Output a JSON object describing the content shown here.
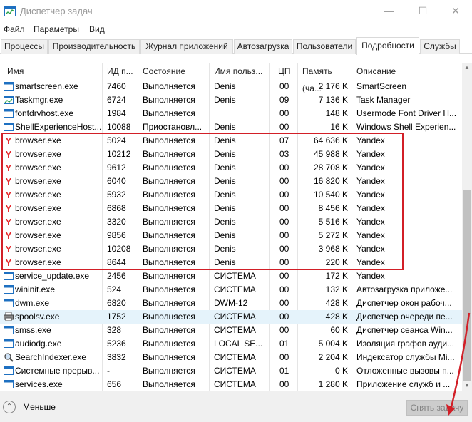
{
  "window": {
    "title": "Диспетчер задач",
    "minimize": "—",
    "maximize": "☐",
    "close": "✕"
  },
  "menu": [
    "Файл",
    "Параметры",
    "Вид"
  ],
  "tabs": [
    {
      "label": "Процессы"
    },
    {
      "label": "Производительность"
    },
    {
      "label": "Журнал приложений"
    },
    {
      "label": "Автозагрузка"
    },
    {
      "label": "Пользователи"
    },
    {
      "label": "Подробности",
      "active": true
    },
    {
      "label": "Службы"
    }
  ],
  "columns": [
    "Имя",
    "ИД п...",
    "Состояние",
    "Имя польз...",
    "ЦП",
    "Память (ча...",
    "Описание"
  ],
  "sort_indicator": "^",
  "processes": [
    {
      "name": "smartscreen.exe",
      "pid": "7460",
      "status": "Выполняется",
      "user": "Denis",
      "cpu": "00",
      "mem": "2 176 K",
      "desc": "SmartScreen",
      "icon": "app-window-icon"
    },
    {
      "name": "Taskmgr.exe",
      "pid": "6724",
      "status": "Выполняется",
      "user": "Denis",
      "cpu": "09",
      "mem": "7 136 K",
      "desc": "Task Manager",
      "icon": "task-manager-icon"
    },
    {
      "name": "fontdrvhost.exe",
      "pid": "1984",
      "status": "Выполняется",
      "user": "",
      "cpu": "00",
      "mem": "148 K",
      "desc": "Usermode Font Driver H...",
      "icon": "app-window-icon"
    },
    {
      "name": "ShellExperienceHost....",
      "pid": "10088",
      "status": "Приостановл...",
      "user": "Denis",
      "cpu": "00",
      "mem": "16 K",
      "desc": "Windows Shell Experien...",
      "icon": "app-window-icon"
    },
    {
      "name": "browser.exe",
      "pid": "5024",
      "status": "Выполняется",
      "user": "Denis",
      "cpu": "07",
      "mem": "64 636 K",
      "desc": "Yandex",
      "icon": "yandex-icon"
    },
    {
      "name": "browser.exe",
      "pid": "10212",
      "status": "Выполняется",
      "user": "Denis",
      "cpu": "03",
      "mem": "45 988 K",
      "desc": "Yandex",
      "icon": "yandex-icon"
    },
    {
      "name": "browser.exe",
      "pid": "9612",
      "status": "Выполняется",
      "user": "Denis",
      "cpu": "00",
      "mem": "28 708 K",
      "desc": "Yandex",
      "icon": "yandex-icon"
    },
    {
      "name": "browser.exe",
      "pid": "6040",
      "status": "Выполняется",
      "user": "Denis",
      "cpu": "00",
      "mem": "16 820 K",
      "desc": "Yandex",
      "icon": "yandex-icon"
    },
    {
      "name": "browser.exe",
      "pid": "5932",
      "status": "Выполняется",
      "user": "Denis",
      "cpu": "00",
      "mem": "10 540 K",
      "desc": "Yandex",
      "icon": "yandex-icon"
    },
    {
      "name": "browser.exe",
      "pid": "6868",
      "status": "Выполняется",
      "user": "Denis",
      "cpu": "00",
      "mem": "8 456 K",
      "desc": "Yandex",
      "icon": "yandex-icon"
    },
    {
      "name": "browser.exe",
      "pid": "3320",
      "status": "Выполняется",
      "user": "Denis",
      "cpu": "00",
      "mem": "5 516 K",
      "desc": "Yandex",
      "icon": "yandex-icon"
    },
    {
      "name": "browser.exe",
      "pid": "9856",
      "status": "Выполняется",
      "user": "Denis",
      "cpu": "00",
      "mem": "5 272 K",
      "desc": "Yandex",
      "icon": "yandex-icon"
    },
    {
      "name": "browser.exe",
      "pid": "10208",
      "status": "Выполняется",
      "user": "Denis",
      "cpu": "00",
      "mem": "3 968 K",
      "desc": "Yandex",
      "icon": "yandex-icon"
    },
    {
      "name": "browser.exe",
      "pid": "8644",
      "status": "Выполняется",
      "user": "Denis",
      "cpu": "00",
      "mem": "220 K",
      "desc": "Yandex",
      "icon": "yandex-icon"
    },
    {
      "name": "service_update.exe",
      "pid": "2456",
      "status": "Выполняется",
      "user": "СИСТЕМА",
      "cpu": "00",
      "mem": "172 K",
      "desc": "Yandex",
      "icon": "app-window-icon"
    },
    {
      "name": "wininit.exe",
      "pid": "524",
      "status": "Выполняется",
      "user": "СИСТЕМА",
      "cpu": "00",
      "mem": "132 K",
      "desc": "Автозагрузка приложе...",
      "icon": "app-window-icon"
    },
    {
      "name": "dwm.exe",
      "pid": "6820",
      "status": "Выполняется",
      "user": "DWM-12",
      "cpu": "00",
      "mem": "428 K",
      "desc": "Диспетчер окон рабоч...",
      "icon": "app-window-icon"
    },
    {
      "name": "spoolsv.exe",
      "pid": "1752",
      "status": "Выполняется",
      "user": "СИСТЕМА",
      "cpu": "00",
      "mem": "428 K",
      "desc": "Диспетчер очереди пе...",
      "icon": "printer-icon",
      "highlight": true
    },
    {
      "name": "smss.exe",
      "pid": "328",
      "status": "Выполняется",
      "user": "СИСТЕМА",
      "cpu": "00",
      "mem": "60 K",
      "desc": "Диспетчер сеанса Win...",
      "icon": "app-window-icon"
    },
    {
      "name": "audiodg.exe",
      "pid": "5236",
      "status": "Выполняется",
      "user": "LOCAL SE...",
      "cpu": "01",
      "mem": "5 004 K",
      "desc": "Изоляция графов ауди...",
      "icon": "app-window-icon"
    },
    {
      "name": "SearchIndexer.exe",
      "pid": "3832",
      "status": "Выполняется",
      "user": "СИСТЕМА",
      "cpu": "00",
      "mem": "2 204 K",
      "desc": "Индексатор службы Mi...",
      "icon": "search-indexer-icon"
    },
    {
      "name": "Системные прерыв...",
      "pid": "-",
      "status": "Выполняется",
      "user": "СИСТЕМА",
      "cpu": "01",
      "mem": "0 K",
      "desc": "Отложенные вызовы п...",
      "icon": "app-window-icon"
    },
    {
      "name": "services.exe",
      "pid": "656",
      "status": "Выполняется",
      "user": "СИСТЕМА",
      "cpu": "00",
      "mem": "1 280 K",
      "desc": "Приложение служб и ...",
      "icon": "app-window-icon"
    }
  ],
  "footer": {
    "less_label": "Меньше",
    "end_task_label": "Снять задачу"
  },
  "colors": {
    "selection_box": "#d21f27",
    "yandex_red": "#e4282c",
    "icon_blue": "#1e70c1"
  }
}
